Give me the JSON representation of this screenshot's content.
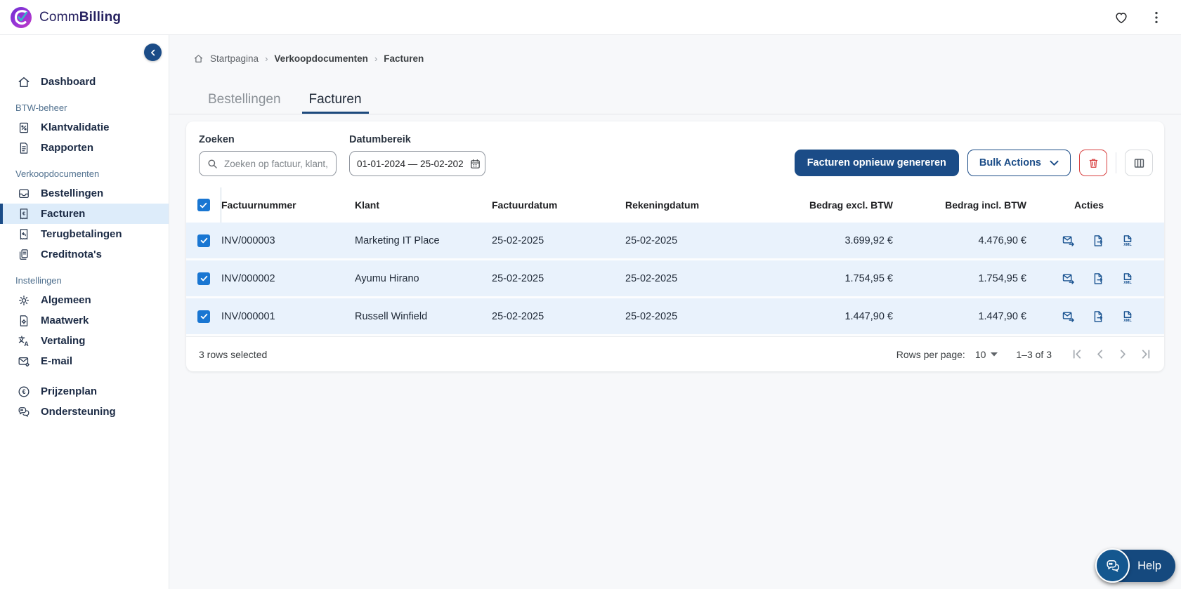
{
  "topbar": {
    "brand": {
      "prefix": "Comm",
      "suffix": "Billing"
    },
    "icons": {
      "favorites": "heart-icon",
      "menu": "kebab-menu-icon"
    }
  },
  "sidebar": {
    "groups": [
      {
        "items": [
          {
            "label": "Dashboard",
            "icon": "home"
          }
        ]
      },
      {
        "label": "BTW-beheer",
        "items": [
          {
            "label": "Klantvalidatie",
            "icon": "receipt-percent"
          },
          {
            "label": "Rapporten",
            "icon": "report-document"
          }
        ]
      },
      {
        "label": "Verkoopdocumenten",
        "items": [
          {
            "label": "Bestellingen",
            "icon": "inbox"
          },
          {
            "label": "Facturen",
            "icon": "invoice-euro",
            "active": true
          },
          {
            "label": "Terugbetalingen",
            "icon": "refund-receipt"
          },
          {
            "label": "Creditnota's",
            "icon": "credit-notes"
          }
        ]
      },
      {
        "label": "Instellingen",
        "items": [
          {
            "label": "Algemeen",
            "icon": "gear"
          },
          {
            "label": "Maatwerk",
            "icon": "custom-document"
          },
          {
            "label": "Vertaling",
            "icon": "translate"
          },
          {
            "label": "E-mail",
            "icon": "mail-settings"
          }
        ]
      },
      {
        "items": [
          {
            "label": "Prijzenplan",
            "icon": "euro-circle"
          },
          {
            "label": "Ondersteuning",
            "icon": "support-chat"
          }
        ]
      }
    ]
  },
  "breadcrumb": {
    "items": [
      "Startpagina",
      "Verkoopdocumenten",
      "Facturen"
    ]
  },
  "tabs": [
    {
      "label": "Bestellingen",
      "active": false
    },
    {
      "label": "Facturen",
      "active": true
    }
  ],
  "filters": {
    "search": {
      "label": "Zoeken",
      "placeholder": "Zoeken op factuur, klant,"
    },
    "date_range": {
      "label": "Datumbereik",
      "value": "01-01-2024 — 25-02-202"
    },
    "regenerate_button": "Facturen opnieuw genereren",
    "bulk_actions_button": "Bulk Actions"
  },
  "table": {
    "columns": [
      "Factuurnummer",
      "Klant",
      "Factuurdatum",
      "Rekeningdatum",
      "Bedrag excl. BTW",
      "Bedrag incl. BTW",
      "Acties"
    ],
    "rows": [
      {
        "invoice_number": "INV/000003",
        "client": "Marketing IT Place",
        "invoice_date": "25-02-2025",
        "billing_date": "25-02-2025",
        "amount_excl_vat": "3.699,92 €",
        "amount_incl_vat": "4.476,90 €",
        "selected": true
      },
      {
        "invoice_number": "INV/000002",
        "client": "Ayumu Hirano",
        "invoice_date": "25-02-2025",
        "billing_date": "25-02-2025",
        "amount_excl_vat": "1.754,95 €",
        "amount_incl_vat": "1.754,95 €",
        "selected": true
      },
      {
        "invoice_number": "INV/000001",
        "client": "Russell Winfield",
        "invoice_date": "25-02-2025",
        "billing_date": "25-02-2025",
        "amount_excl_vat": "1.447,90 €",
        "amount_incl_vat": "1.447,90 €",
        "selected": true
      }
    ],
    "row_actions": [
      "send-email",
      "export-document",
      "download-xml"
    ]
  },
  "pagination": {
    "selected_text": "3 rows selected",
    "rows_per_page_label": "Rows per page:",
    "rows_per_page_value": "10",
    "range_text": "1–3 of 3"
  },
  "help": {
    "label": "Help"
  },
  "colors": {
    "primary": "#1b4c87",
    "checkbox_blue": "#1976d2",
    "danger": "#d84040",
    "selected_row_bg": "#e9f2fc",
    "active_nav_bg": "#ddecfa"
  }
}
